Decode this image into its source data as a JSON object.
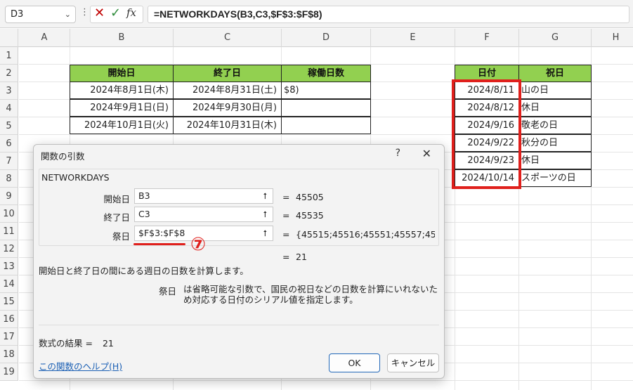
{
  "formula_bar": {
    "name_box": "D3",
    "name_box_arrow": "⌄",
    "dots": "⋮",
    "cancel_icon": "✕",
    "enter_icon": "✓",
    "fx_label": "fx",
    "formula": "=NETWORKDAYS(B3,C3,$F$3:$F$8)"
  },
  "columns": [
    "A",
    "B",
    "C",
    "D",
    "E",
    "F",
    "G",
    "H"
  ],
  "rows": [
    "1",
    "2",
    "3",
    "4",
    "5",
    "6",
    "7",
    "8",
    "9",
    "10",
    "11",
    "12",
    "13",
    "14",
    "15",
    "16",
    "17",
    "18",
    "19"
  ],
  "table1": {
    "headers": [
      "開始日",
      "終了日",
      "稼働日数"
    ],
    "rows": [
      [
        "2024年8月1日(木)",
        "2024年8月31日(土)",
        "$8)"
      ],
      [
        "2024年9月1日(日)",
        "2024年9月30日(月)",
        ""
      ],
      [
        "2024年10月1日(火)",
        "2024年10月31日(木)",
        ""
      ]
    ]
  },
  "table2": {
    "headers": [
      "日付",
      "祝日"
    ],
    "rows": [
      [
        "2024/8/11",
        "山の日"
      ],
      [
        "2024/8/12",
        "休日"
      ],
      [
        "2024/9/16",
        "敬老の日"
      ],
      [
        "2024/9/22",
        "秋分の日"
      ],
      [
        "2024/9/23",
        "休日"
      ],
      [
        "2024/10/14",
        "スポーツの日"
      ]
    ]
  },
  "dialog": {
    "title": "関数の引数",
    "help_icon": "?",
    "close_icon": "✕",
    "function_name": "NETWORKDAYS",
    "args": [
      {
        "label": "開始日",
        "value": "B3",
        "eq": "=",
        "result": "45505"
      },
      {
        "label": "終了日",
        "value": "C3",
        "eq": "=",
        "result": "45535"
      },
      {
        "label": "祭日",
        "value": "$F$3:$F$8",
        "eq": "=",
        "result": "{45515;45516;45551;45557;45558"
      }
    ],
    "ref_icon": "⭡",
    "total_eq": "=",
    "total_result": "21",
    "marker": "⑦",
    "description": "開始日と終了日の間にある週日の日数を計算します。",
    "param_name": "祭日",
    "param_desc": "は省略可能な引数で、国民の祝日などの日数を計算にいれないため対応する日付のシリアル値を指定します。",
    "result_label": "数式の結果 =",
    "result_value": "21",
    "help_link": "この関数のヘルプ(H)",
    "ok": "OK",
    "cancel": "キャンセル"
  }
}
